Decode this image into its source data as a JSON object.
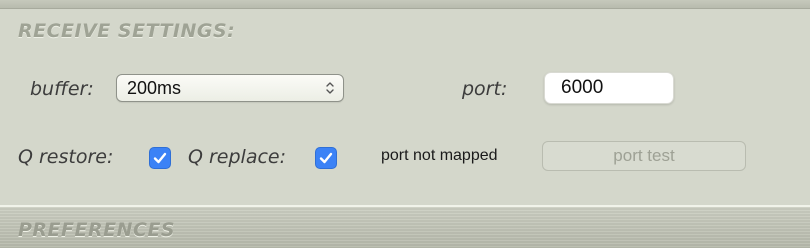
{
  "receive_settings": {
    "title": "RECEIVE SETTINGS:",
    "buffer_label": "buffer:",
    "buffer_value": "200ms",
    "port_label": "port:",
    "port_value": "6000",
    "q_restore_label": "Q restore:",
    "q_restore_checked": true,
    "q_replace_label": "Q replace:",
    "q_replace_checked": true,
    "port_status": "port not mapped",
    "port_test_label": "port test"
  },
  "preferences": {
    "title": "PREFERENCES"
  },
  "colors": {
    "panel_background": "#d4d7cb",
    "checkbox_accent": "#3b82f6",
    "section_title": "#9fa395"
  },
  "icons": {
    "select_arrows": "chevron-up-down-icon",
    "checkbox_check": "checkmark-icon"
  }
}
